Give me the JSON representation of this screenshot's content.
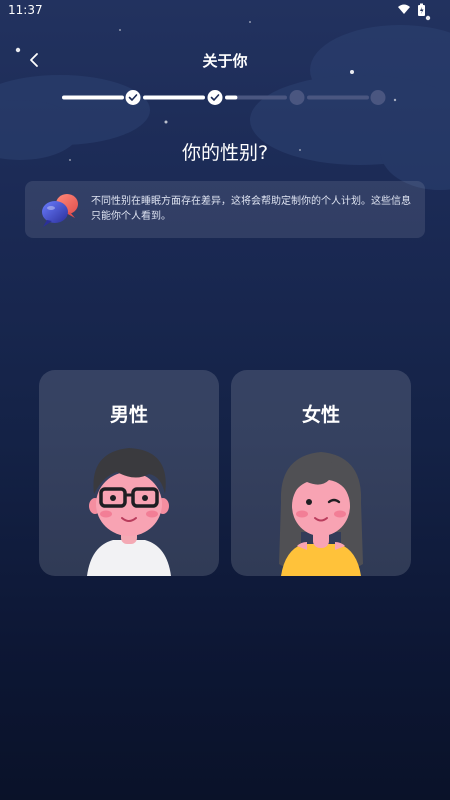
{
  "status_bar": {
    "time": "11:37",
    "icons": [
      "wifi-icon",
      "battery-icon"
    ]
  },
  "header": {
    "title": "关于你",
    "back_icon": "chevron-left-icon"
  },
  "progress": {
    "total_steps": 5,
    "completed_steps": 2,
    "current_step": 3,
    "current_fraction": 0.2,
    "active_color": "#ffffff",
    "inactive_color": "#4a5680"
  },
  "question": {
    "text": "你的性别?"
  },
  "info": {
    "icon": "chat-bubbles-icon",
    "text": "不同性别在睡眠方面存在差异，这将会帮助定制你的个人计划。这些信息只能你个人看到。"
  },
  "options": [
    {
      "label": "男性",
      "avatar": "male-avatar"
    },
    {
      "label": "女性",
      "avatar": "female-avatar"
    }
  ]
}
